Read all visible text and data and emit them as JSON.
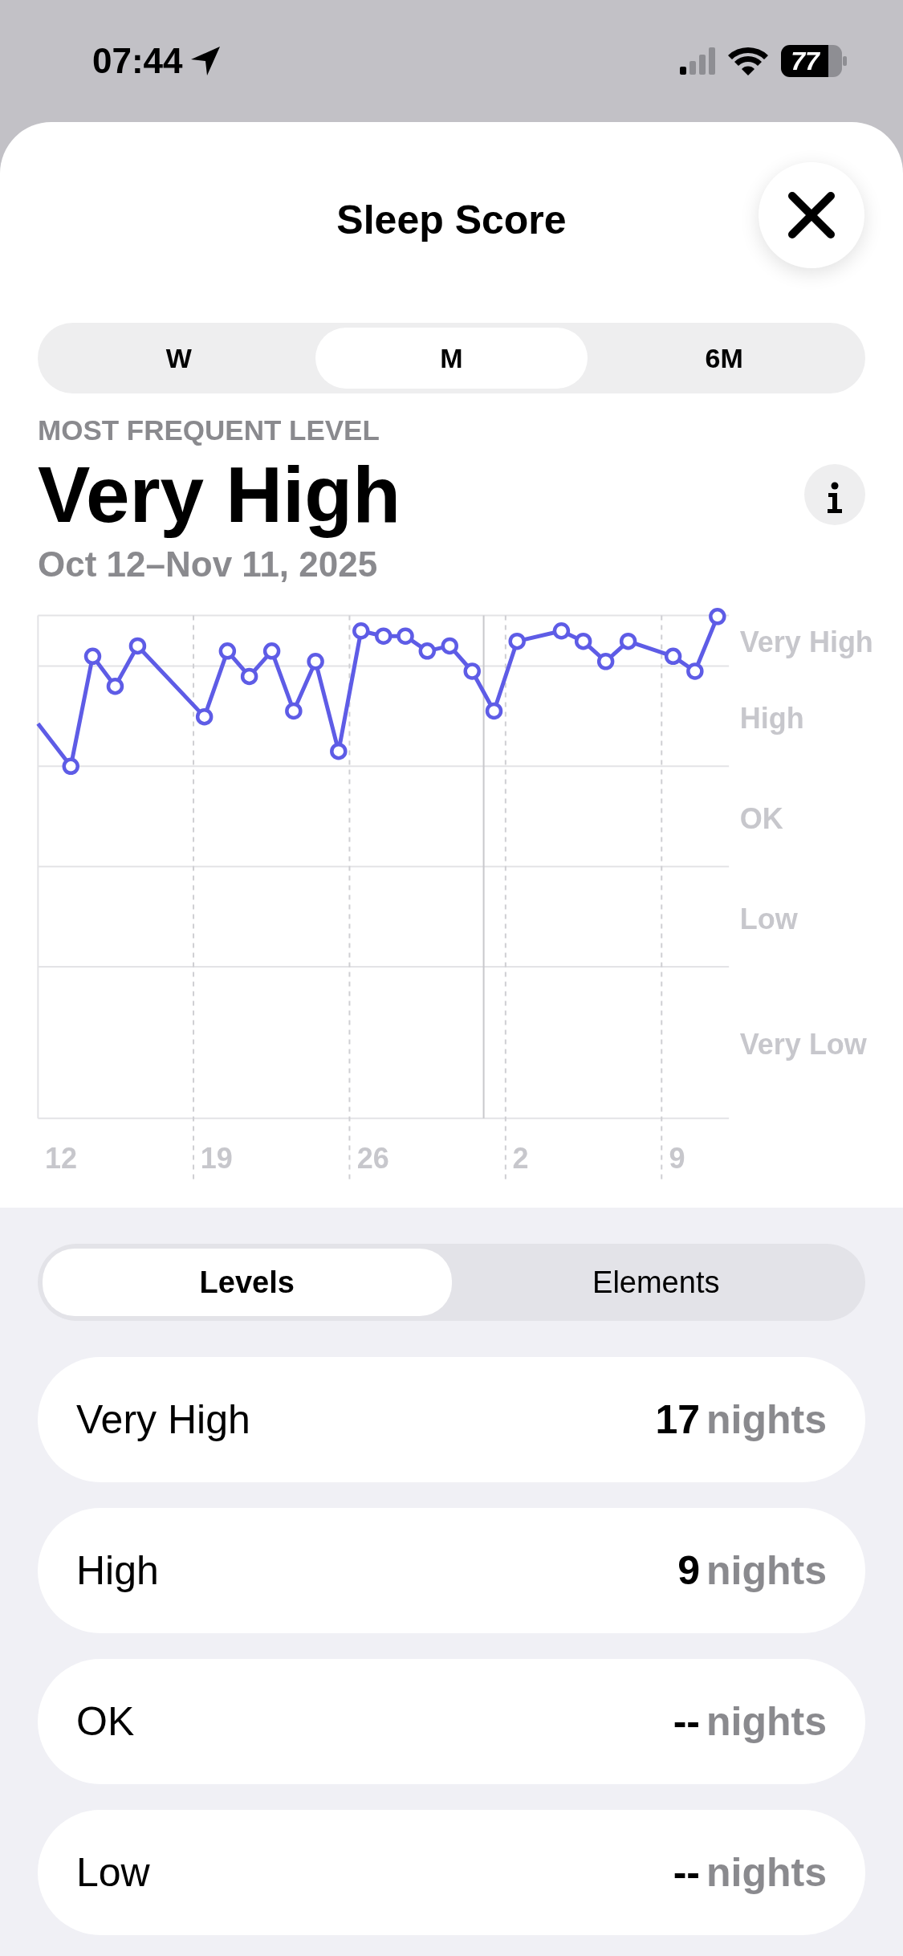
{
  "status_bar": {
    "time": "07:44",
    "battery": "77"
  },
  "sheet": {
    "title": "Sleep Score"
  },
  "range_tabs": [
    {
      "label": "W",
      "selected": false
    },
    {
      "label": "M",
      "selected": true
    },
    {
      "label": "6M",
      "selected": false
    }
  ],
  "summary": {
    "caption": "MOST FREQUENT LEVEL",
    "value": "Very High",
    "date_range": "Oct 12–Nov 11, 2025"
  },
  "chart": {
    "y_labels": [
      "Very High",
      "High",
      "OK",
      "Low",
      "Very Low"
    ],
    "x_labels": [
      "12",
      "19",
      "26",
      "2",
      "9"
    ]
  },
  "view_tabs": [
    {
      "label": "Levels",
      "selected": true
    },
    {
      "label": "Elements",
      "selected": false
    }
  ],
  "levels": [
    {
      "name": "Very High",
      "count": "17",
      "unit": "nights"
    },
    {
      "name": "High",
      "count": "9",
      "unit": "nights"
    },
    {
      "name": "OK",
      "count": "--",
      "unit": "nights"
    },
    {
      "name": "Low",
      "count": "--",
      "unit": "nights"
    }
  ]
}
